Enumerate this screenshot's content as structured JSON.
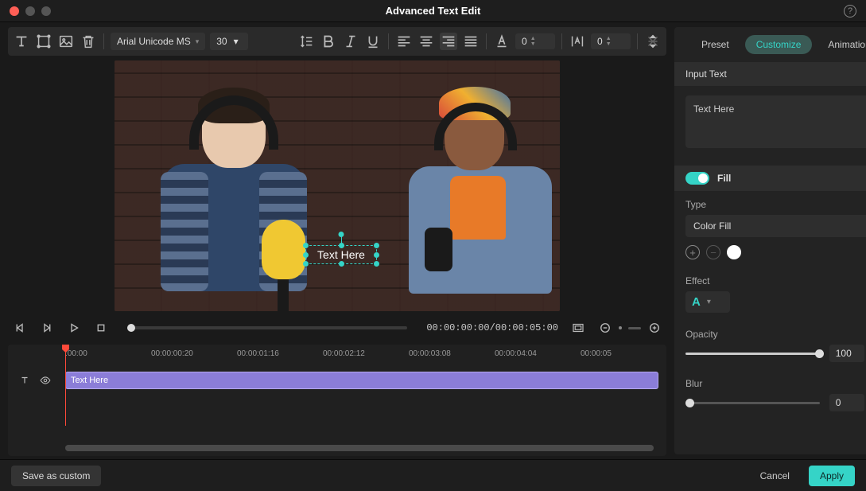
{
  "window": {
    "title": "Advanced Text Edit"
  },
  "toolbar": {
    "font_family": "Arial Unicode MS",
    "font_size": "30",
    "tracking": "0",
    "leading": "0"
  },
  "preview": {
    "text_overlay": "Text Here"
  },
  "player": {
    "timecode": "00:00:00:00/00:00:05:00"
  },
  "timeline": {
    "ticks": [
      ":00:00",
      "00:00:00:20",
      "00:00:01:16",
      "00:00:02:12",
      "00:00:03:08",
      "00:00:04:04",
      "00:00:05"
    ],
    "clip_label": "Text Here"
  },
  "tabs": {
    "preset": "Preset",
    "customize": "Customize",
    "animation": "Animation"
  },
  "panel": {
    "input_header": "Input Text",
    "input_value": "Text Here",
    "fill_label": "Fill",
    "type_label": "Type",
    "type_value": "Color Fill",
    "effect_label": "Effect",
    "effect_letter": "A",
    "opacity_label": "Opacity",
    "opacity_value": "100",
    "opacity_unit": "%",
    "blur_label": "Blur",
    "blur_value": "0"
  },
  "footer": {
    "save_custom": "Save as custom",
    "cancel": "Cancel",
    "apply": "Apply"
  }
}
